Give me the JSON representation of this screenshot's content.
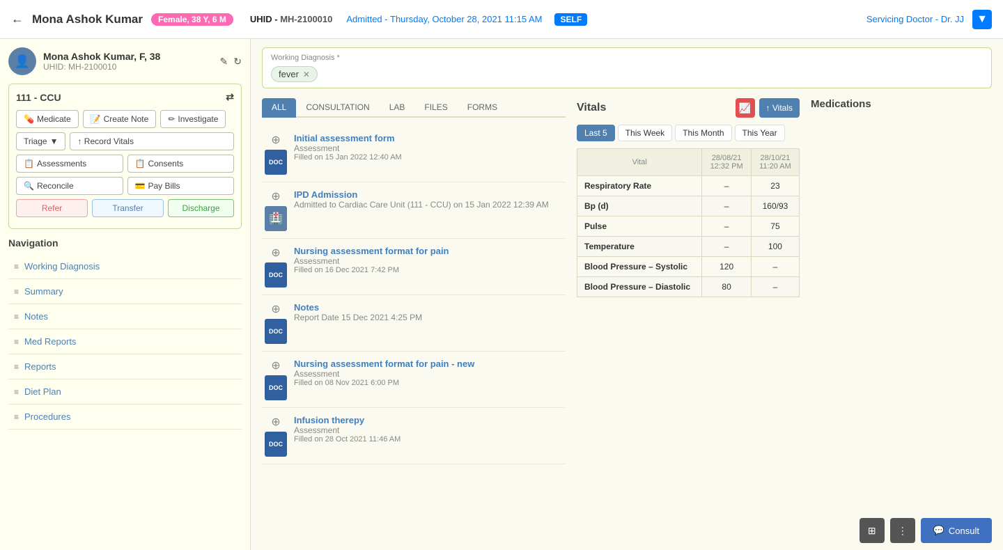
{
  "header": {
    "back_icon": "←",
    "patient_name": "Mona Ashok Kumar",
    "gender_badge": "Female, 38 Y, 6 M",
    "uhid_label": "UHID -",
    "uhid_value": "MH-2100010",
    "admitted_label": "Admitted -",
    "admitted_date": "Thursday, October 28, 2021 11:15 AM",
    "self_badge": "SELF",
    "doctor_label": "Servicing Doctor -",
    "doctor_name": "Dr. JJ",
    "dots_icon": "▼"
  },
  "patient_card": {
    "name": "Mona Ashok Kumar, F, 38",
    "uhid_label": "UHID:",
    "uhid_value": "MH-2100010",
    "edit_icon": "✎",
    "refresh_icon": "↻",
    "avatar_icon": "👤"
  },
  "ward": {
    "title": "111 - CCU",
    "transfer_icon": "⇄",
    "buttons": [
      {
        "label": "Medicate",
        "icon": "💊"
      },
      {
        "label": "Create Note",
        "icon": "📝"
      },
      {
        "label": "Investigate",
        "icon": "✏️"
      }
    ],
    "triage_label": "Triage",
    "triage_arrow": "▼",
    "record_vitals_label": "↑ Record Vitals",
    "assessments_label": "Assessments",
    "consents_label": "Consents",
    "reconcile_label": "Reconcile",
    "pay_bills_label": "Pay Bills",
    "refer_label": "Refer",
    "transfer_label": "Transfer",
    "discharge_label": "Discharge"
  },
  "navigation": {
    "title": "Navigation",
    "items": [
      {
        "label": "Working Diagnosis",
        "icon": "≡"
      },
      {
        "label": "Summary",
        "icon": "≡"
      },
      {
        "label": "Notes",
        "icon": "≡"
      },
      {
        "label": "Med Reports",
        "icon": "≡"
      },
      {
        "label": "Reports",
        "icon": "≡"
      },
      {
        "label": "Diet Plan",
        "icon": "≡"
      },
      {
        "label": "Procedures",
        "icon": "≡"
      }
    ]
  },
  "working_diagnosis": {
    "label": "Working Diagnosis *",
    "tag": "fever",
    "close_icon": "✕"
  },
  "tabs": [
    {
      "label": "ALL",
      "active": true
    },
    {
      "label": "CONSULTATION",
      "active": false
    },
    {
      "label": "LAB",
      "active": false
    },
    {
      "label": "FILES",
      "active": false
    },
    {
      "label": "FORMS",
      "active": false
    }
  ],
  "documents": [
    {
      "title": "Initial assessment form",
      "type": "Assessment",
      "date": "Filled on 15 Jan 2022 12:40 AM",
      "icon": "DOC"
    },
    {
      "title": "IPD Admission",
      "type": "Admitted to Cardiac Care Unit (111 - CCU) on 15 Jan 2022 12:39 AM",
      "date": "",
      "icon": "🏥"
    },
    {
      "title": "Nursing assessment format for pain",
      "type": "Assessment",
      "date": "Filled on 16 Dec 2021 7:42 PM",
      "icon": "DOC"
    },
    {
      "title": "Notes",
      "type": "Report Date 15 Dec 2021 4:25 PM",
      "date": "",
      "icon": "DOC"
    },
    {
      "title": "Nursing assessment format for pain - new",
      "type": "Assessment",
      "date": "Filled on 08 Nov 2021 6:00 PM",
      "icon": "DOC"
    },
    {
      "title": "Infusion therepy",
      "type": "Assessment",
      "date": "Filled on 28 Oct 2021 11:46 AM",
      "icon": "DOC"
    }
  ],
  "vitals": {
    "title": "Vitals",
    "trend_icon": "📈",
    "add_label": "↑ Vitals",
    "time_tabs": [
      {
        "label": "Last 5",
        "active": true
      },
      {
        "label": "This Week",
        "active": false
      },
      {
        "label": "This Month",
        "active": false
      },
      {
        "label": "This Year",
        "active": false
      }
    ],
    "col1_date": "28/08/21",
    "col1_time": "12:32 PM",
    "col2_date": "28/10/21",
    "col2_time": "11:20 AM",
    "rows": [
      {
        "label": "Vital",
        "col1": "",
        "col2": ""
      },
      {
        "label": "Respiratory Rate",
        "col1": "–",
        "col2": "23"
      },
      {
        "label": "Bp (d)",
        "col1": "–",
        "col2": "160/93"
      },
      {
        "label": "Pulse",
        "col1": "–",
        "col2": "75"
      },
      {
        "label": "Temperature",
        "col1": "–",
        "col2": "100"
      },
      {
        "label": "Blood Pressure – Systolic",
        "col1": "120",
        "col2": "–"
      },
      {
        "label": "Blood Pressure – Diastolic",
        "col1": "80",
        "col2": "–"
      }
    ]
  },
  "medications": {
    "title": "Medications"
  },
  "bottom_bar": {
    "grid_icon": "⊞",
    "dots_icon": "⋮",
    "consult_icon": "💬",
    "consult_label": "Consult"
  }
}
